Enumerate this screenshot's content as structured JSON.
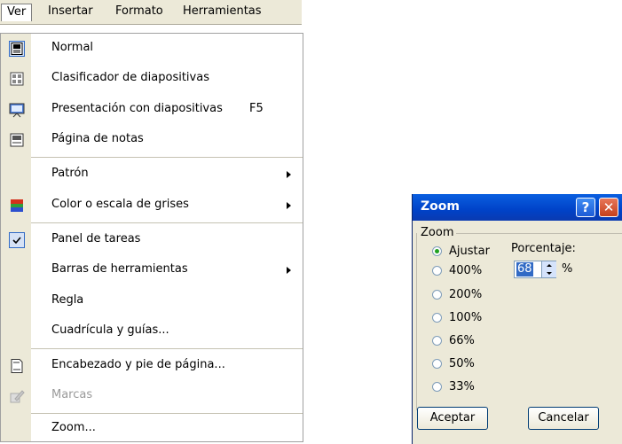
{
  "menubar": {
    "items": [
      "Ver",
      "Insertar",
      "Formato",
      "Herramientas"
    ]
  },
  "menu": {
    "items": [
      {
        "label": "Normal",
        "icon": "normal-view-icon",
        "checked_frame": true
      },
      {
        "label": "Clasificador de diapositivas",
        "icon": "slide-sorter-icon"
      },
      {
        "label": "Presentación con diapositivas",
        "shortcut": "F5",
        "icon": "slideshow-icon"
      },
      {
        "label": "Página de notas",
        "icon": "notes-page-icon"
      },
      {
        "label": "Patrón",
        "submenu": true
      },
      {
        "label": "Color o escala de grises",
        "submenu": true,
        "icon": "color-grayscale-icon"
      },
      {
        "label": "Panel de tareas",
        "checked": true
      },
      {
        "label": "Barras de herramientas",
        "submenu": true
      },
      {
        "label": "Regla"
      },
      {
        "label": "Cuadrícula y guías..."
      },
      {
        "label": "Encabezado y pie de página...",
        "icon": "header-footer-icon"
      },
      {
        "label": "Marcas",
        "disabled": true,
        "icon": "markup-icon"
      },
      {
        "label": "Zoom..."
      }
    ]
  },
  "dialog": {
    "title": "Zoom",
    "help_glyph": "?",
    "close_glyph": "✕",
    "group_label": "Zoom",
    "options": [
      "Ajustar",
      "400%",
      "200%",
      "100%",
      "66%",
      "50%",
      "33%"
    ],
    "selected": "Ajustar",
    "percent_label": "Porcentaje:",
    "percent_value": "68",
    "percent_sign": "%",
    "ok_label": "Aceptar",
    "cancel_label": "Cancelar"
  }
}
